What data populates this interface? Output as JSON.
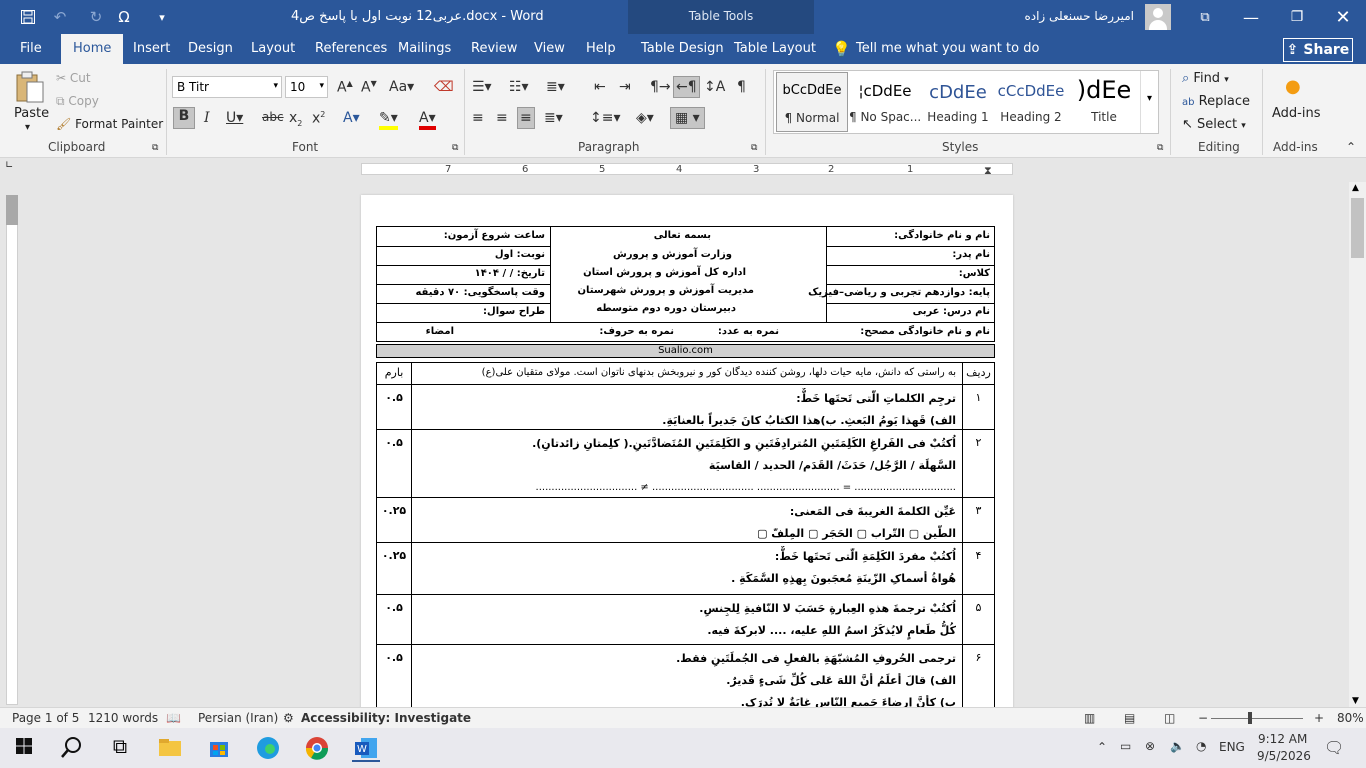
{
  "titlebar": {
    "doc_title": "عربی12 نوبت اول با پاسخ ص4.docx  -  Word",
    "contextual": "Table Tools",
    "user": "امیررضا حسنعلی زاده"
  },
  "tabs": {
    "file": "File",
    "home": "Home",
    "insert": "Insert",
    "design": "Design",
    "layout": "Layout",
    "references": "References",
    "mailings": "Mailings",
    "review": "Review",
    "view": "View",
    "help": "Help",
    "table_design": "Table Design",
    "table_layout": "Table Layout",
    "tell_me": "Tell me what you want to do",
    "share": "Share"
  },
  "clipboard": {
    "paste": "Paste",
    "cut": "Cut",
    "copy": "Copy",
    "format_painter": "Format Painter",
    "label": "Clipboard"
  },
  "font": {
    "name": "B Titr",
    "size": "10",
    "label": "Font"
  },
  "paragraph": {
    "label": "Paragraph"
  },
  "styles": {
    "label": "Styles",
    "items": [
      {
        "preview": "bCcDdEe",
        "name": "¶ Normal"
      },
      {
        "preview": "¦cDdEe",
        "name": "¶ No Spac..."
      },
      {
        "preview": "cDdEe",
        "name": "Heading 1"
      },
      {
        "preview": "cCcDdEe",
        "name": "Heading 2"
      },
      {
        "preview": ")dEe",
        "name": "Title"
      }
    ]
  },
  "editing": {
    "find": "Find",
    "replace": "Replace",
    "select": "Select",
    "label": "Editing"
  },
  "addins": {
    "button": "Add-ins",
    "label": "Add-ins"
  },
  "ruler": {
    "numbers": [
      "7",
      "6",
      "5",
      "4",
      "3",
      "2",
      "1"
    ]
  },
  "document": {
    "header": {
      "student_name": "نام و نام خانوادگی:",
      "father_name": "نام پدر:",
      "class": "کلاس:",
      "grade": "پایه: دوازدهم تجربی و ریاضی–فیزیک",
      "subject": "نام درس: عربی",
      "god_name": "بسمه تعالی",
      "ministry": "وزارت آموزش و پرورش",
      "province": "اداره کل آموزش و پرورش استان",
      "county": "مدیریت آموزش و پرورش شهرستان",
      "school": "دبیرستان دوره دوم متوسطه",
      "start_time": "ساعت شروع آزمون:",
      "session": "نوبت: اول",
      "date": "تاریخ:  /  /  ۱۴۰۴",
      "duration": "وقت پاسخگویی: ۷۰ دقیقه",
      "designer": "طراح سوال:",
      "corrector": "نام و نام خانوادگی مصحح:",
      "score_num": "نمره به عدد:",
      "score_word": "نمره به حروف:",
      "signature": "امضاء"
    },
    "watermark_site": "Sualio.com",
    "quote_row": {
      "num_header": "ردیف",
      "quote": "به راستی که دانش، مایه حیات دلها، روشن کننده دیدگان کور و نیروبخش بدنهای ناتوان است. مولای متقیان علی(ع)",
      "score_header": "بارم"
    },
    "questions": [
      {
        "num": "۱",
        "score": "۰.۵",
        "lines": [
          "ترجِم الکلماتِ الّتی تَحتَها خَطٌّ:",
          "الف) قَهذا یَومُ البَعثِ.            ب)هذا الکتابُ کانَ جَدیراً بالعنایَةِ."
        ]
      },
      {
        "num": "۲",
        "score": "۰.۵",
        "lines": [
          "اُکتُبْ فی الفَراغِ الکَلِمَتَینِ المُترادِفَتَینِ و الکَلِمَتَینِ المُتَضادَّتَینِ.( کلِمتانِ زائدتانِ).",
          "السَّهلَة / الرَّجُل/ حَدَثَ/ القَدَم/ الحدید / القاسیَة",
          "................................ = ..........................     ................................ ≠ ................................"
        ]
      },
      {
        "num": "۳",
        "score": "۰.۲۵",
        "lines": [
          "عَیِّن الکلمةَ الغریبةَ فی المَعنی:",
          "الطّین ▢      التّراب ▢      الحَجَر ▢      المِلفّ ▢"
        ]
      },
      {
        "num": "۴",
        "score": "۰.۲۵",
        "lines": [
          "اُکتُبْ مفردَ الکَلِمَةِ الّتی تَحتَها خَطٌّ:",
          "هُواةُ أسماکِ الزّینَةِ مُعجَبونَ بِهذِهِ السَّمَکَةِ ."
        ]
      },
      {
        "num": "۵",
        "score": "۰.۵",
        "lines": [
          "اُکتُبْ ترجمةَ هذهِ العِبارةِ حَسَبَ لا النّافیةِ لِلجِنسِ.",
          "کُلُّ طَعامٍ لایُذکَرُ اسمُ اللهِ علیه، .... لابرکةَ فیه."
        ]
      },
      {
        "num": "۶",
        "score": "۰.۵",
        "lines": [
          "ترجمی الحُروفِ المُشبّهَةِ بالفعلِ فی الجُملَتَینِ فقط.",
          "الف) قالَ أعلَمُ أنَّ اللهَ عَلی کُلِّ شَیءٍ قَدیرٌ.",
          "ب) کأنَّ إرضاءَ جَمیعِ النّاسِ غایَةٌ لا تُدرَک."
        ]
      }
    ]
  },
  "status": {
    "page": "Page 1 of 5",
    "words": "1210 words",
    "language": "Persian (Iran)",
    "accessibility": "Accessibility: Investigate",
    "zoom": "80%"
  },
  "taskbar": {
    "lang": "ENG",
    "time": "9:12 AM",
    "date": "9/5/2026"
  }
}
